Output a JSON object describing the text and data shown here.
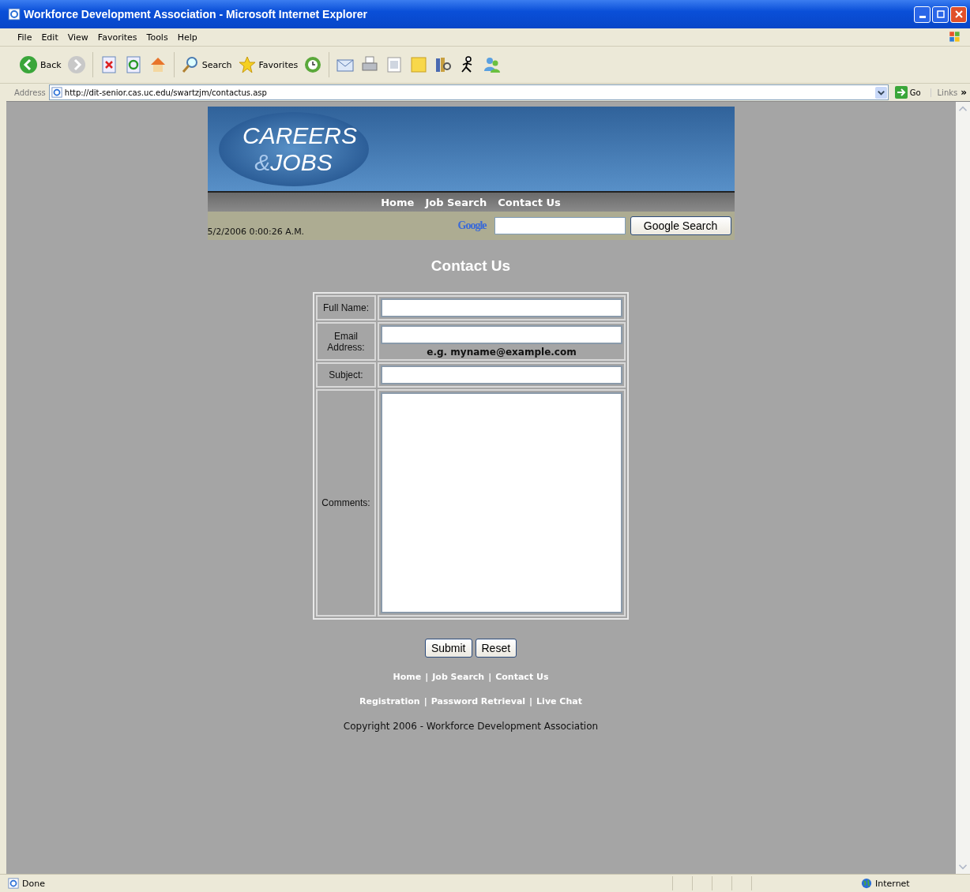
{
  "window": {
    "title": "Workforce Development Association - Microsoft Internet Explorer"
  },
  "menu": [
    "File",
    "Edit",
    "View",
    "Favorites",
    "Tools",
    "Help"
  ],
  "toolbar": [
    {
      "kind": "back",
      "label": "Back"
    },
    {
      "kind": "forward"
    },
    {
      "kind": "stop"
    },
    {
      "kind": "refresh"
    },
    {
      "kind": "home"
    },
    {
      "kind": "search",
      "label": "Search"
    },
    {
      "kind": "favorites",
      "label": "Favorites"
    },
    {
      "kind": "history"
    },
    {
      "kind": "mail"
    },
    {
      "kind": "print"
    },
    {
      "kind": "edit"
    },
    {
      "kind": "note"
    },
    {
      "kind": "research"
    },
    {
      "kind": "aim"
    },
    {
      "kind": "messenger"
    }
  ],
  "address": {
    "label": "Address",
    "url": "http://dit-senior.cas.uc.edu/swartzjm/contactus.asp",
    "go": "Go",
    "links": "Links",
    "more": "»"
  },
  "page": {
    "logo": [
      "CAREERS",
      "&",
      "JOBS"
    ],
    "nav": [
      "Home",
      "Job Search",
      "Contact Us"
    ],
    "date": "5/2/2006 0:00:26 A.M.",
    "google": {
      "logo": "Google",
      "button": "Google Search"
    },
    "heading": "Contact Us",
    "fields": [
      {
        "label": "Full Name:",
        "kind": "text"
      },
      {
        "label": "Email Address:",
        "kind": "text",
        "hint": "e.g. myname@example.com"
      },
      {
        "label": "Subject:",
        "kind": "text"
      },
      {
        "label": "Comments:",
        "kind": "textarea"
      }
    ],
    "buttons": [
      "Submit",
      "Reset"
    ],
    "separator": "|",
    "footer_links": [
      [
        "Home",
        "Job Search",
        "Contact Us"
      ],
      [
        "Registration",
        "Password Retrieval",
        "Live Chat"
      ]
    ],
    "copyright": "Copyright 2006 - Workforce Development Association"
  },
  "status_bar": {
    "text": "Done",
    "zone": "Internet"
  }
}
